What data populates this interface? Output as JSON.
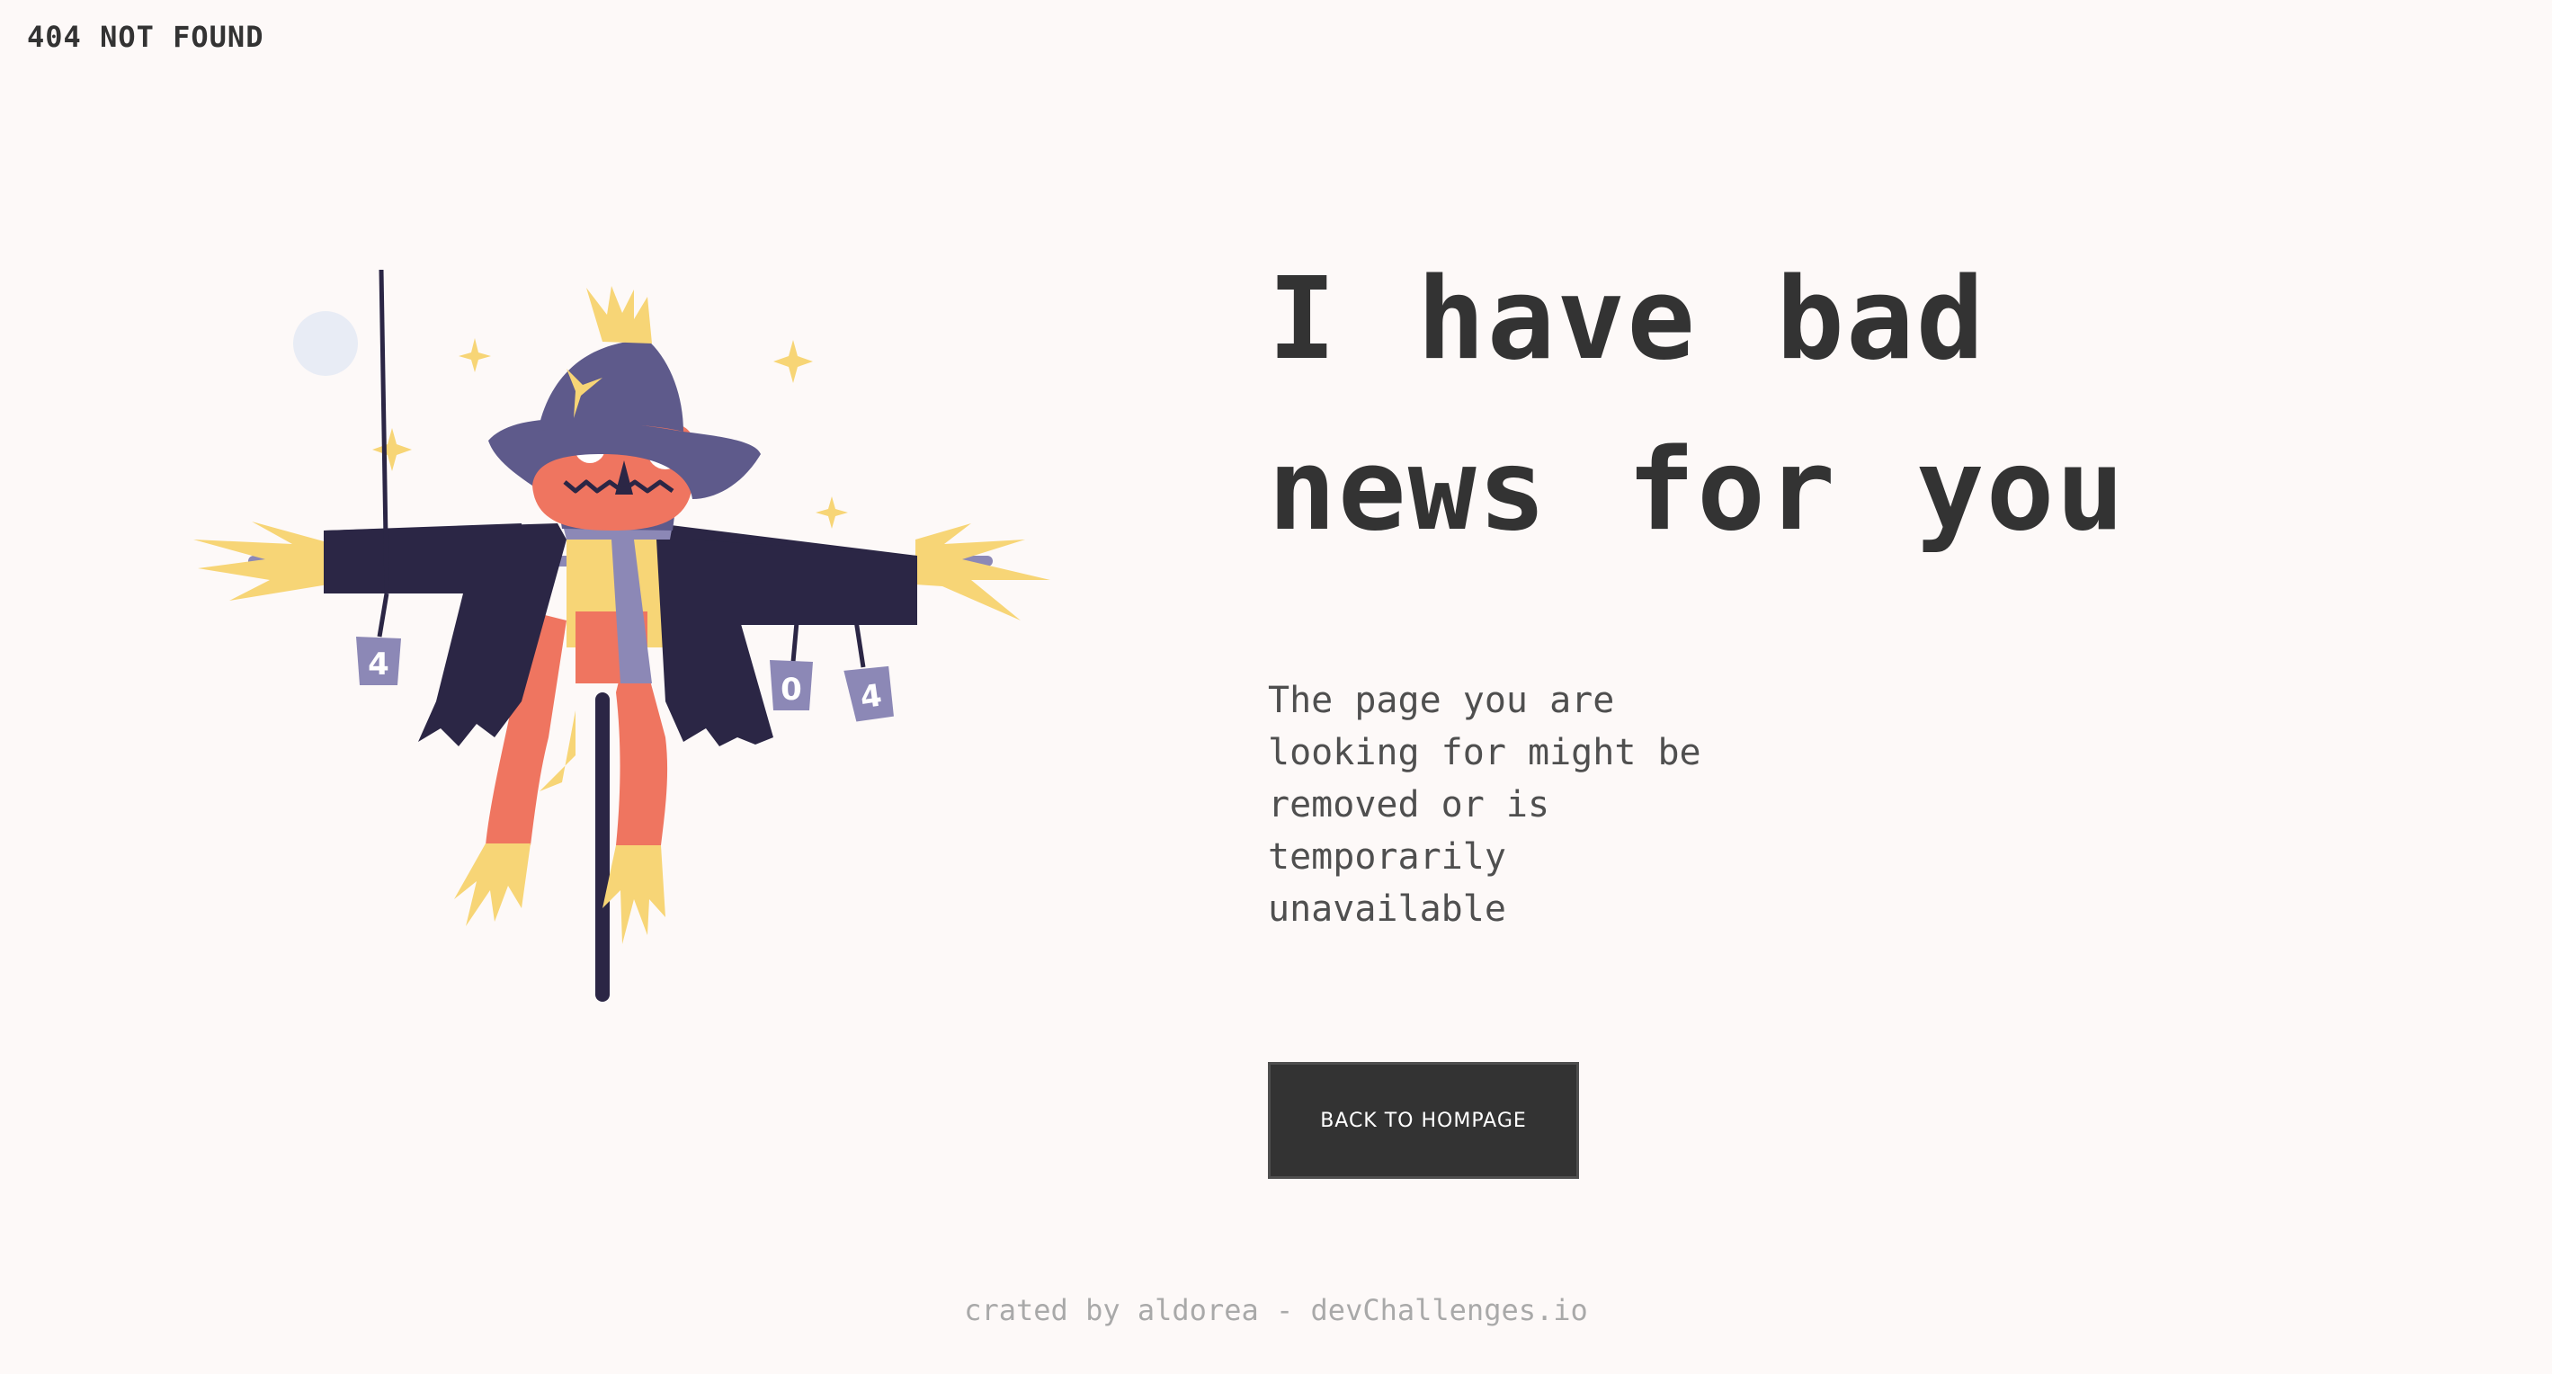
{
  "header": {
    "brand": "404 NOT FOUND"
  },
  "hero": {
    "headline_line1": "I have bad",
    "headline_line2": "news for you",
    "message_lines": [
      "The page you are",
      "looking for might be",
      "removed or is",
      "temporarily",
      "unavailable"
    ],
    "button_label": "BACK TO HOMPAGE"
  },
  "illustration": {
    "can_labels": [
      "4",
      "0",
      "4"
    ]
  },
  "footer": {
    "text": "crated by aldorea - devChallenges.io"
  },
  "colors": {
    "background": "#fdf9f8",
    "text_dark": "#333333",
    "text_muted": "#a9a9a9",
    "coat": "#2b2645",
    "hat": "#5e5a8b",
    "straw": "#f7d576",
    "face": "#ef7560",
    "can": "#8c88b6",
    "moon": "#e8ecf5"
  }
}
